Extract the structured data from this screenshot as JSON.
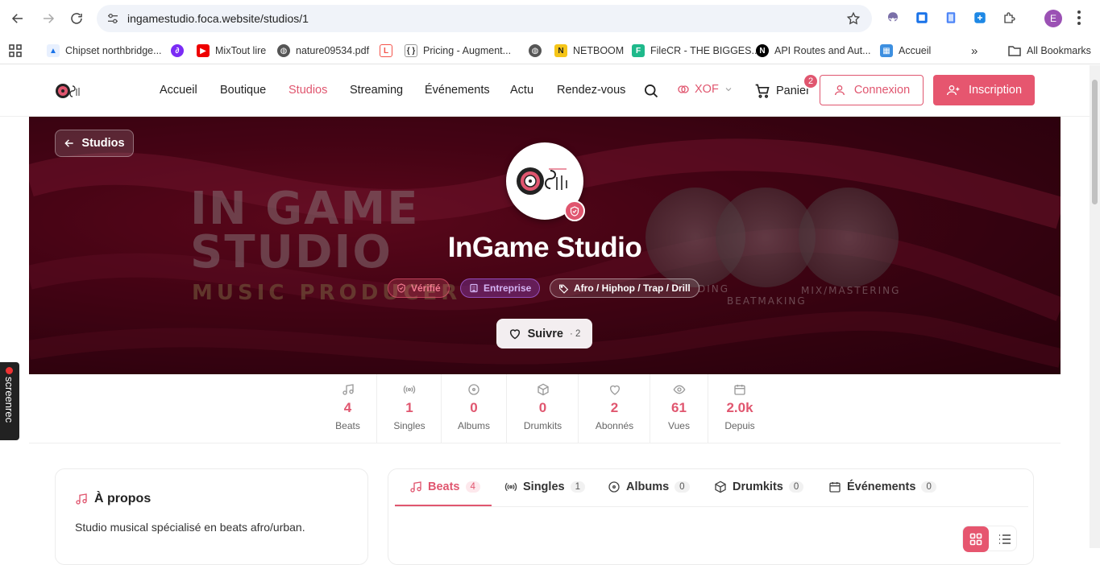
{
  "browser": {
    "url": "ingamestudio.foca.website/studios/1",
    "profile_initial": "E",
    "bookmarks": [
      {
        "label": "Chipset northbridge...",
        "icon": "chart-icon"
      },
      {
        "label": "",
        "icon": "circle-swirl-icon"
      },
      {
        "label": "MixTout lire",
        "icon": "youtube-icon"
      },
      {
        "label": "nature09534.pdf",
        "icon": "globe-icon"
      },
      {
        "label": "",
        "icon": "laravel-icon"
      },
      {
        "label": "Pricing - Augment...",
        "icon": "bracket-icon"
      },
      {
        "label": "",
        "icon": "globe-icon"
      },
      {
        "label": "NETBOOM",
        "icon": "netboom-icon"
      },
      {
        "label": "FileCR - THE BIGGES...",
        "icon": "filecr-icon"
      },
      {
        "label": "API Routes and Aut...",
        "icon": "nextjs-icon"
      },
      {
        "label": "Accueil",
        "icon": "accueil-icon"
      }
    ],
    "more_bookmarks": "»",
    "all_bookmarks": "All Bookmarks"
  },
  "header": {
    "nav": [
      "Accueil",
      "Boutique",
      "Studios",
      "Streaming",
      "Événements",
      "Actu",
      "Rendez-vous"
    ],
    "active_nav": "Studios",
    "currency": "XOF",
    "cart_label": "Panier",
    "cart_count": "2",
    "login_label": "Connexion",
    "signup_label": "Inscription",
    "accent_color": "#e0566f"
  },
  "hero": {
    "back_label": "Studios",
    "studio_name": "InGame Studio",
    "banner_text_line1": "IN GAME",
    "banner_text_line2": "STUDIO",
    "banner_subtitle": "MUSIC PRODUCER",
    "banner_labels": [
      "DING",
      "BEATMAKING",
      "MIX/MASTERING"
    ],
    "tags": {
      "verified": "Vérifié",
      "company": "Entreprise",
      "genre": "Afro / Hiphop / Trap / Drill"
    },
    "follow_label": "Suivre",
    "follow_count": "· 2"
  },
  "stats": [
    {
      "icon": "music-note-icon",
      "value": "4",
      "label": "Beats"
    },
    {
      "icon": "broadcast-icon",
      "value": "1",
      "label": "Singles"
    },
    {
      "icon": "disc-icon",
      "value": "0",
      "label": "Albums"
    },
    {
      "icon": "box-icon",
      "value": "0",
      "label": "Drumkits"
    },
    {
      "icon": "heart-icon",
      "value": "2",
      "label": "Abonnés"
    },
    {
      "icon": "eye-icon",
      "value": "61",
      "label": "Vues"
    },
    {
      "icon": "calendar-icon",
      "value": "2.0k",
      "label": "Depuis"
    }
  ],
  "about": {
    "title": "À propos",
    "text": "Studio musical spécialisé en beats afro/urban."
  },
  "tabs": [
    {
      "label": "Beats",
      "count": "4",
      "icon": "music-note-icon"
    },
    {
      "label": "Singles",
      "count": "1",
      "icon": "broadcast-icon"
    },
    {
      "label": "Albums",
      "count": "0",
      "icon": "disc-icon"
    },
    {
      "label": "Drumkits",
      "count": "0",
      "icon": "box-icon"
    },
    {
      "label": "Événements",
      "count": "0",
      "icon": "calendar-icon"
    }
  ],
  "recorder_label": "screenrec"
}
